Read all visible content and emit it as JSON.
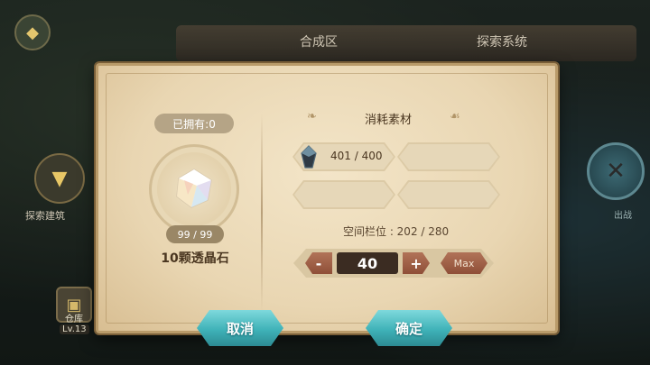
{
  "scene": {
    "tabs": [
      "合成区",
      "探索系统"
    ],
    "side_left_label": "探索建筑",
    "side_right_label": "出战",
    "warehouse_label": "仓库",
    "warehouse_level": "Lv.13"
  },
  "dialog": {
    "owned": "已拥有:0",
    "item_count": "99 / 99",
    "item_name": "10颗透晶石",
    "section_title": "消耗素材",
    "materials": [
      {
        "icon": "crystal-shard-icon",
        "qty": "401 / 400"
      }
    ],
    "space_info": "空间栏位 : 202 / 280",
    "quantity": "40",
    "minus": "-",
    "plus": "+",
    "max_label": "Max",
    "cancel_label": "取消",
    "confirm_label": "确定"
  },
  "colors": {
    "parchment": "#efe0c2",
    "action_teal": "#3fb2b8",
    "stepper_red": "#9b5a41"
  }
}
